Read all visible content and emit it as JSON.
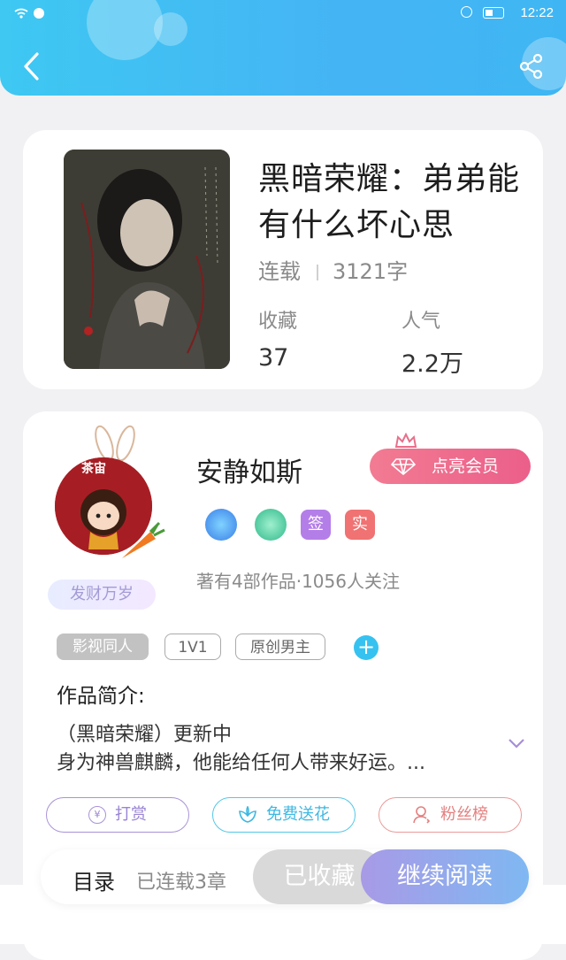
{
  "status_bar": {
    "time": "12:22"
  },
  "book": {
    "title": "黑暗荣耀：弟弟能有什么坏心思",
    "status": "连载",
    "word_count": "3121字",
    "favorites_label": "收藏",
    "favorites_value": "37",
    "popularity_label": "人气",
    "popularity_value": "2.2万"
  },
  "author": {
    "name": "安静如斯",
    "vip_label": "点亮会员",
    "badge_sign": "签",
    "badge_real": "实",
    "works_info": "著有4部作品·1056人关注",
    "avatar_label": "茶宙",
    "fortune_tag": "发财万岁"
  },
  "tags": [
    "影视同人",
    "1V1",
    "原创男主"
  ],
  "intro": {
    "heading": "作品简介:",
    "line1": "（黑暗荣耀）更新中",
    "line2": "身为神兽麒麟，他能给任何人带来好运。..."
  },
  "actions": {
    "tip": "打赏",
    "flower": "免费送花",
    "fans": "粉丝榜"
  },
  "bottom_bar": {
    "toc": "目录",
    "serial_info": "已连载3章",
    "favorited": "已收藏",
    "continue": "继续阅读"
  },
  "colors": {
    "header": "#45b4f4",
    "vip": "#eb5f8a",
    "accent": "#36c2f0"
  }
}
